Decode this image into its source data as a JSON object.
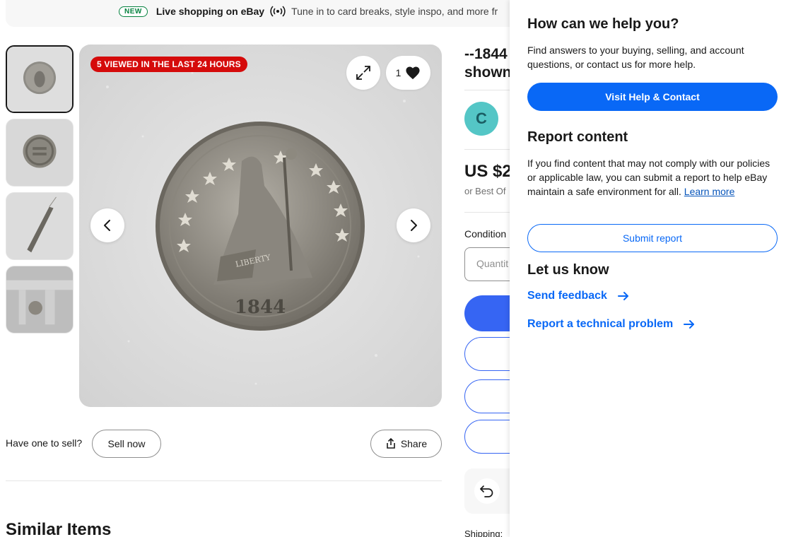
{
  "banner": {
    "badge": "NEW",
    "title": "Live shopping on eBay",
    "text": "Tune in to card breaks, style inspo, and more fr"
  },
  "thumbnails": [
    {
      "name": "thumbnail-coin-obverse",
      "selected": true
    },
    {
      "name": "thumbnail-coin-reverse",
      "selected": false
    },
    {
      "name": "thumbnail-coin-edge",
      "selected": false
    },
    {
      "name": "thumbnail-coin-caliper",
      "selected": false
    }
  ],
  "gallery": {
    "viewed_badge": "5 VIEWED IN THE LAST 24 HOURS",
    "watch_count": "1",
    "coin_year": "1844",
    "coin_ribbon": "LIBERTY"
  },
  "sell": {
    "label": "Have one to sell?",
    "sell_button": "Sell now",
    "share_button": "Share"
  },
  "similar": {
    "title": "Similar Items"
  },
  "item": {
    "title_line1": "--1844",
    "title_line2": "shown",
    "seller_initial": "C",
    "price": "US $2",
    "best_offer": "or Best Of",
    "condition": "Condition",
    "quantity_placeholder": "Quantit",
    "shipping": "Shipping:"
  },
  "help_panel": {
    "heading1": "How can we help you?",
    "text1": "Find answers to your buying, selling, and account questions, or contact us for more help.",
    "visit_button": "Visit Help & Contact",
    "heading2": "Report content",
    "text2": "If you find content that may not comply with our policies or applicable law, you can submit a report to help eBay maintain a safe environment for all.",
    "learn_more": "Learn more",
    "submit_button": "Submit report",
    "heading3": "Let us know",
    "link1": "Send feedback",
    "link2": "Report a technical problem"
  },
  "colors": {
    "accent_blue": "#0968f6",
    "badge_red": "#d50b0b",
    "new_green": "#05823f",
    "avatar_teal": "#54c6c6"
  }
}
